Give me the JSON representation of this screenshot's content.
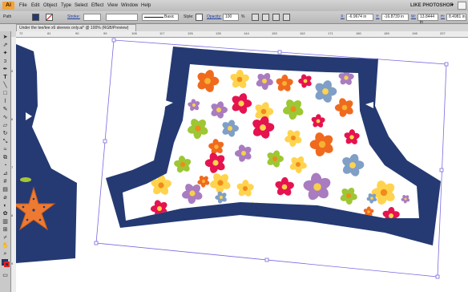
{
  "app": {
    "logo": "Ai"
  },
  "menu": [
    "File",
    "Edit",
    "Object",
    "Type",
    "Select",
    "Effect",
    "View",
    "Window",
    "Help"
  ],
  "workspace": {
    "label": "LIKE PHOTOSHOP",
    "arrow": "▾"
  },
  "control": {
    "selection": "Path",
    "stroke_label": "Stroke:",
    "profile_label": "Basic",
    "style_label": "Style:",
    "opacity_label": "Opacity:",
    "opacity_value": "100",
    "opacity_unit": "%",
    "x_label": "X:",
    "x_value": "-6.9674 in",
    "y_label": "Y:",
    "y_value": "-16.8739 in",
    "w_label": "W:",
    "w_value": "13.8444 in",
    "h_label": "H:",
    "h_value": "8.4981 in"
  },
  "document": {
    "tab_title": "Under the tee/tee x6 sleeves only.ai* @ 100% (RGB/Preview)"
  },
  "ruler": {
    "h_ticks": [
      "72",
      "81",
      "90",
      "99",
      "108",
      "117",
      "126",
      "135",
      "144",
      "153",
      "162",
      "171",
      "180",
      "189",
      "198",
      "207"
    ],
    "v_ticks": [
      "5",
      "6",
      "7",
      "8",
      "9"
    ]
  },
  "colors": {
    "navy": "#253a72",
    "selection": "#7a6ae0",
    "starfish": "#ee7a32",
    "leaf": "#a6c734"
  },
  "tools": [
    "selection-arrow",
    "direct-select",
    "magic-wand",
    "lasso",
    "pen",
    "type",
    "line",
    "rectangle",
    "paintbrush",
    "pencil",
    "blob-brush",
    "eraser",
    "rotate",
    "scale",
    "width",
    "free-transform",
    "shape-builder",
    "perspective",
    "mesh",
    "gradient",
    "eyedropper",
    "blend",
    "symbol-sprayer",
    "column-graph",
    "artboard",
    "slice",
    "hand",
    "zoom",
    "fill-stroke",
    "screen-mode"
  ]
}
